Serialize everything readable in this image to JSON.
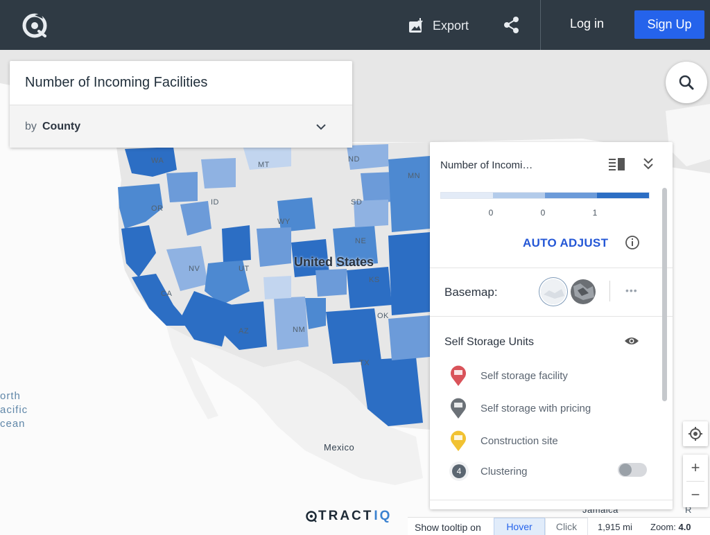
{
  "header": {
    "export_label": "Export",
    "login_label": "Log in",
    "signup_label": "Sign Up"
  },
  "title_card": {
    "title": "Number of Incoming Facilities",
    "by_prefix": "by",
    "by_value": "County"
  },
  "map": {
    "country_label": "United States",
    "states": [
      "WA",
      "MT",
      "ND",
      "MN",
      "OR",
      "ID",
      "SD",
      "WY",
      "NE",
      "NV",
      "UT",
      "KS",
      "CA",
      "OK",
      "AZ",
      "NM",
      "TX"
    ],
    "places": [
      "Mexico",
      "Jamaica"
    ],
    "ocean_lines": [
      "orth",
      "acific",
      "cean"
    ],
    "partial_label": "R",
    "colors": {
      "background": "#fbfbfb",
      "land": "#e8e8e8",
      "mexico": "#f1f1f1",
      "county_dark": "#2c6ec4",
      "county_mid": "#4d89d1",
      "county_light": "#8fb2e2",
      "county_pale": "#c2d5ef"
    }
  },
  "legend": {
    "heading": "Number of Incomi…",
    "scale_colors": [
      "#e3ebf7",
      "#b3cbea",
      "#6c9bd9",
      "#2c6ec4"
    ],
    "scale_labels": [
      "0",
      "0",
      "1"
    ],
    "auto_adjust_label": "AUTO ADJUST",
    "basemap_label": "Basemap:",
    "more_label": "•••",
    "layer_title": "Self Storage Units",
    "items": [
      {
        "label": "Self storage facility",
        "color": "#d9535a",
        "icon": "storage-marker-icon"
      },
      {
        "label": "Self storage with pricing",
        "color": "#6b7177",
        "icon": "storage-marker-icon"
      },
      {
        "label": "Construction site",
        "color": "#f1c232",
        "icon": "construction-marker-icon"
      },
      {
        "label": "Clustering",
        "cluster_count": "4",
        "toggle_on": false
      }
    ]
  },
  "bottom_bar": {
    "brand_left": "TRACT",
    "brand_right": "IQ",
    "tooltip_label": "Show tooltip on",
    "hover_label": "Hover",
    "click_label": "Click",
    "scale_text": "1,915 mi",
    "zoom_label": "Zoom:",
    "zoom_value": "4.0"
  },
  "controls": {
    "zoom_in": "+",
    "zoom_out": "−"
  }
}
